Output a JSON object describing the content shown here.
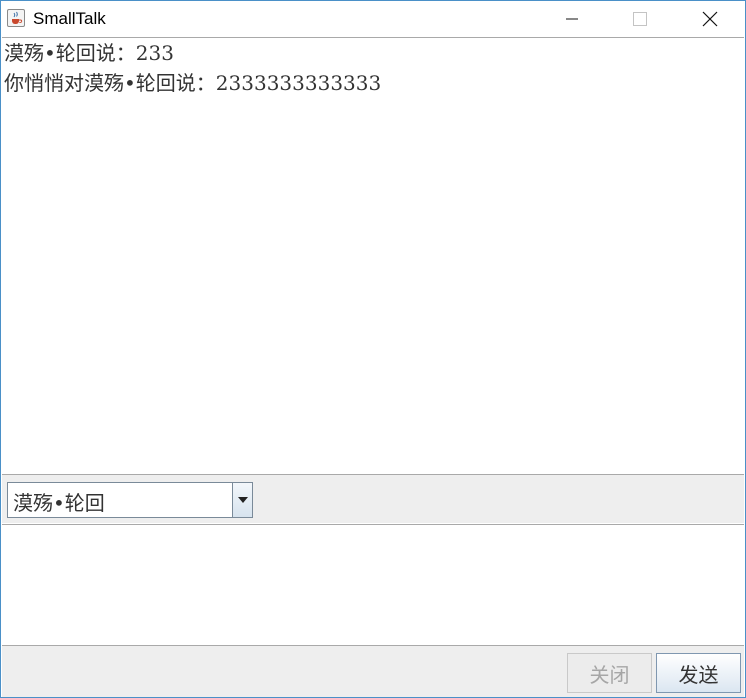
{
  "window": {
    "title": "SmallTalk",
    "icons": {
      "app": "java-coffee-icon",
      "minimize": "minimize-icon",
      "maximize": "maximize-icon",
      "close": "close-icon"
    }
  },
  "chat": {
    "messages": [
      "漠殇•轮回说：233",
      "你悄悄对漠殇•轮回说：2333333333333"
    ]
  },
  "recipient": {
    "selected": "漠殇•轮回",
    "arrow_icon": "chevron-down-icon"
  },
  "input": {
    "value": ""
  },
  "buttons": {
    "close_label": "关闭",
    "send_label": "发送"
  }
}
